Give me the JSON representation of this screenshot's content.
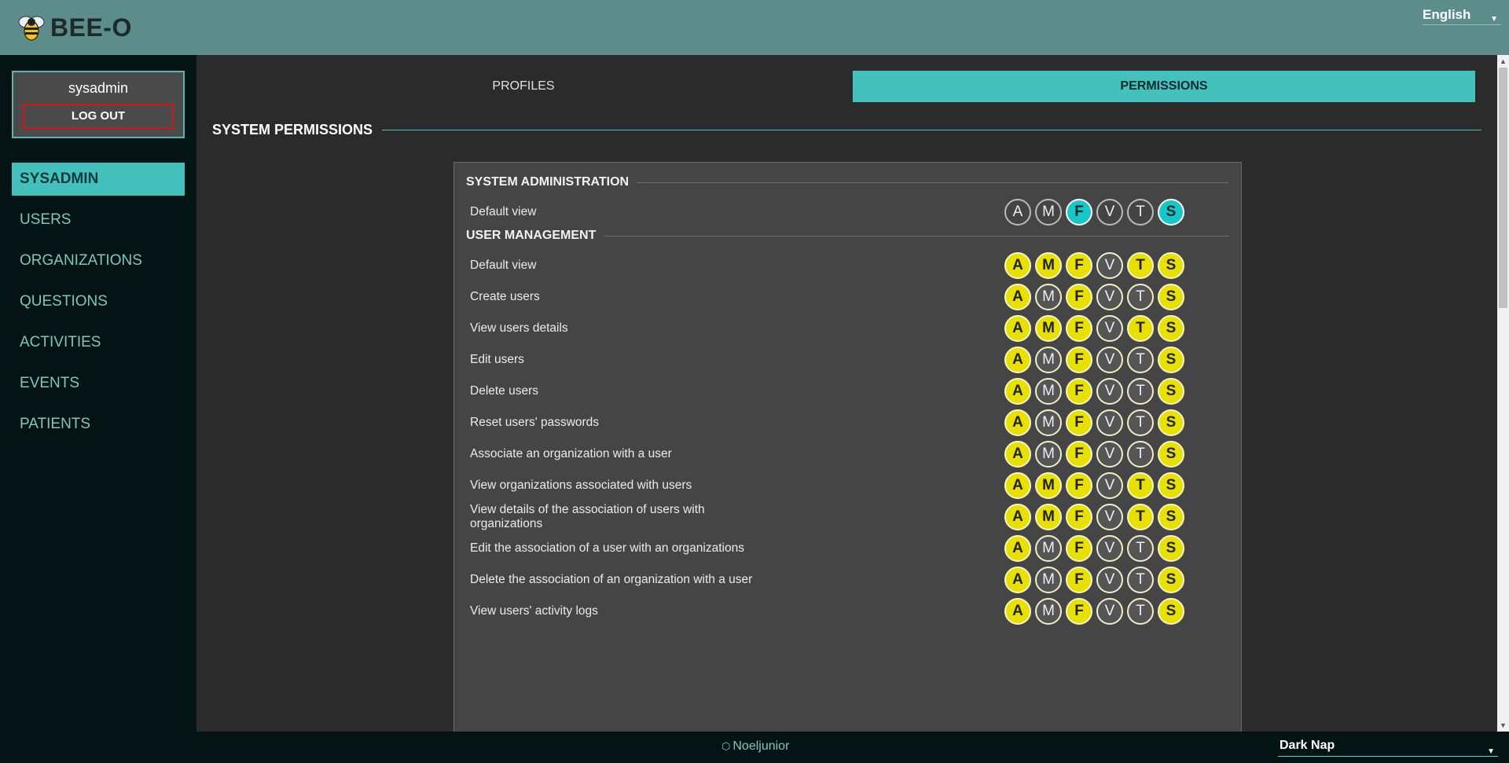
{
  "app": {
    "name": "BEE-O",
    "logo_icon": "bee-icon"
  },
  "language": {
    "selected": "English"
  },
  "user": {
    "name": "sysadmin",
    "logout_label": "LOG OUT"
  },
  "sidebar": {
    "items": [
      {
        "label": "SYSADMIN",
        "active": true
      },
      {
        "label": "USERS",
        "active": false
      },
      {
        "label": "ORGANIZATIONS",
        "active": false
      },
      {
        "label": "QUESTIONS",
        "active": false
      },
      {
        "label": "ACTIVITIES",
        "active": false
      },
      {
        "label": "EVENTS",
        "active": false
      },
      {
        "label": "PATIENTS",
        "active": false
      }
    ]
  },
  "tabs": [
    {
      "label": "PROFILES",
      "active": false
    },
    {
      "label": "PERMISSIONS",
      "active": true
    }
  ],
  "section_title": "SYSTEM PERMISSIONS",
  "profile_letters": [
    "A",
    "M",
    "F",
    "V",
    "T",
    "S"
  ],
  "groups": [
    {
      "title": "SYSTEM ADMINISTRATION",
      "rows": [
        {
          "label": "Default view",
          "enabled": [
            false,
            false,
            true,
            false,
            false,
            true
          ]
        }
      ]
    },
    {
      "title": "USER MANAGEMENT",
      "rows": [
        {
          "label": "Default view",
          "enabled": [
            true,
            true,
            true,
            false,
            true,
            true
          ]
        },
        {
          "label": "Create users",
          "enabled": [
            true,
            false,
            true,
            false,
            false,
            true
          ]
        },
        {
          "label": "View users details",
          "enabled": [
            true,
            true,
            true,
            false,
            true,
            true
          ]
        },
        {
          "label": "Edit users",
          "enabled": [
            true,
            false,
            true,
            false,
            false,
            true
          ]
        },
        {
          "label": "Delete users",
          "enabled": [
            true,
            false,
            true,
            false,
            false,
            true
          ]
        },
        {
          "label": "Reset users' passwords",
          "enabled": [
            true,
            false,
            true,
            false,
            false,
            true
          ]
        },
        {
          "label": "Associate an organization with a user",
          "enabled": [
            true,
            false,
            true,
            false,
            false,
            true
          ]
        },
        {
          "label": "View organizations associated with users",
          "enabled": [
            true,
            true,
            true,
            false,
            true,
            true
          ]
        },
        {
          "label": "View details of the association of users with organizations",
          "enabled": [
            true,
            true,
            true,
            false,
            true,
            true
          ]
        },
        {
          "label": "Edit the association of a user with an organizations",
          "enabled": [
            true,
            false,
            true,
            false,
            false,
            true
          ]
        },
        {
          "label": "Delete the association of an organization with a user",
          "enabled": [
            true,
            false,
            true,
            false,
            false,
            true
          ]
        },
        {
          "label": "View users' activity logs",
          "enabled": [
            true,
            false,
            true,
            false,
            false,
            true
          ]
        }
      ]
    }
  ],
  "footer": {
    "user": "Noeljunior",
    "user_icon": "hexagon-icon"
  },
  "theme": {
    "selected": "Dark Nap"
  },
  "colors": {
    "topbar": "#5c8d8a",
    "accent": "#44c0bd",
    "badge_on": "#e8e000",
    "badge_sysadmin_on": "#17c6c6",
    "logout_border": "#d51515"
  }
}
